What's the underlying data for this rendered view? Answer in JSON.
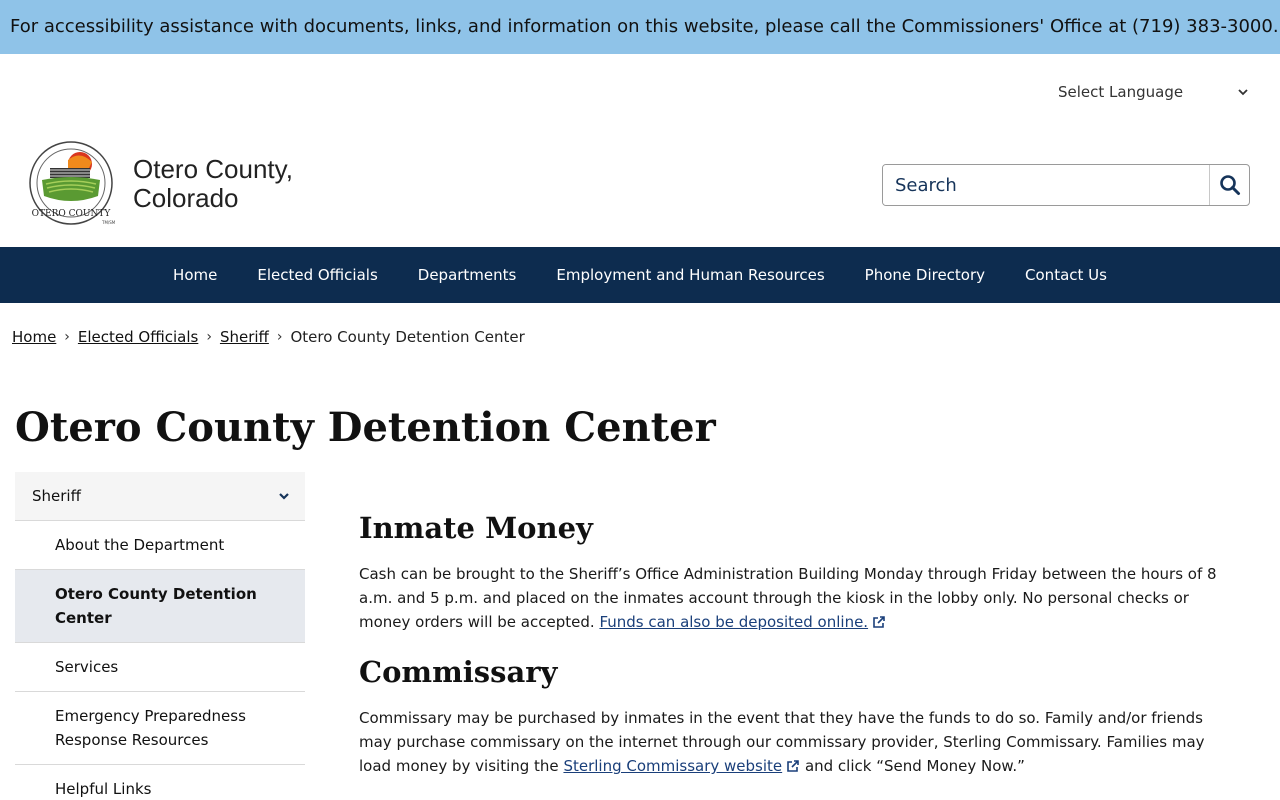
{
  "alert": {
    "text": "For accessibility assistance with documents, links, and information on this website, please call the Commissioners' Office at (719) 383-3000."
  },
  "language": {
    "label": "Select Language"
  },
  "site": {
    "name_line1": "Otero County,",
    "name_line2": "Colorado",
    "logo_text": "OTERO COUNTY",
    "logo_mark": "TM/SM"
  },
  "search": {
    "placeholder": "Search"
  },
  "nav": {
    "items": [
      {
        "label": "Home"
      },
      {
        "label": "Elected Officials"
      },
      {
        "label": "Departments"
      },
      {
        "label": "Employment and Human Resources"
      },
      {
        "label": "Phone Directory"
      },
      {
        "label": "Contact Us"
      }
    ]
  },
  "breadcrumb": {
    "items": [
      {
        "label": "Home"
      },
      {
        "label": "Elected Officials"
      },
      {
        "label": "Sheriff"
      }
    ],
    "current": "Otero County Detention Center"
  },
  "page": {
    "title": "Otero County Detention Center"
  },
  "sidebar": {
    "heading": "Sheriff",
    "items": [
      {
        "label": "About the Department"
      },
      {
        "label": "Otero County Detention Center"
      },
      {
        "label": "Services"
      },
      {
        "label": "Emergency Preparedness Response Resources"
      },
      {
        "label": "Helpful Links"
      }
    ]
  },
  "content": {
    "inmate_money": {
      "heading": "Inmate Money",
      "text": "Cash can be brought to the Sheriff’s Office Administration Building Monday through Friday between the hours of 8 a.m. and 5 p.m. and placed on the inmates account through the kiosk in the lobby only. No personal checks or money orders will be accepted.",
      "link": "Funds can also be deposited online."
    },
    "commissary": {
      "heading": "Commissary",
      "text": "Commissary may be purchased by inmates in the event that they have the funds to do so. Family and/or friends may purchase commissary on the internet through our commissary provider, Sterling Commissary. Families may load money by visiting the",
      "link": "Sterling Commissary website",
      "text_after": "and click “Send Money Now.”"
    }
  },
  "colors": {
    "alert_bg": "#8fc3e8",
    "nav_bg": "#0d2c4f",
    "link": "#1a3f7a",
    "sidebar_active_bg": "#e6e9ee"
  },
  "icons": {
    "search": "search-icon",
    "language_chevron": "chevron-down-icon",
    "sidebar_chevron": "chevron-down-icon",
    "external": "external-link-icon"
  }
}
